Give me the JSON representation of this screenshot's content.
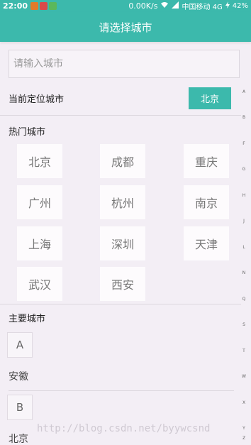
{
  "status_bar": {
    "time": "22:00",
    "speed": "0.00K/s",
    "carrier": "中国移动 4G",
    "battery": "42%"
  },
  "title": "请选择城市",
  "search": {
    "placeholder": "请输入城市"
  },
  "current_city": {
    "label": "当前定位城市",
    "city": "北京"
  },
  "hot_cities": {
    "title": "热门城市",
    "items": [
      "北京",
      "成都",
      "重庆",
      "广州",
      "杭州",
      "南京",
      "上海",
      "深圳",
      "天津",
      "武汉",
      "西安"
    ]
  },
  "main_cities": {
    "title": "主要城市",
    "groups": [
      {
        "letter": "A",
        "cities": [
          "安徽"
        ]
      },
      {
        "letter": "B",
        "cities": [
          "北京"
        ]
      }
    ]
  },
  "index_letters": [
    "A",
    "B",
    "F",
    "G",
    "H",
    "J",
    "L",
    "N",
    "Q",
    "S",
    "T",
    "W",
    "X",
    "Y",
    "Z"
  ],
  "watermark": "http://blog.csdn.net/byywcsnd"
}
